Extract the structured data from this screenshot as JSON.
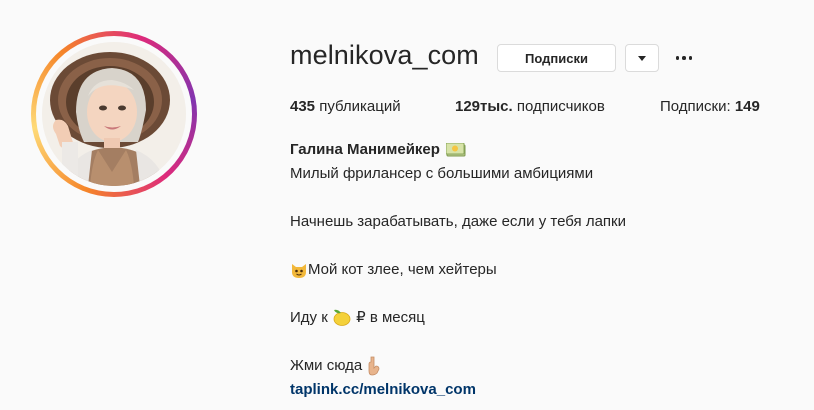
{
  "profile": {
    "username": "melnikova_com",
    "following_button": "Подписки",
    "stats": {
      "posts_count": "435",
      "posts_label": "публикаций",
      "followers_count": "129тыс.",
      "followers_label": "подписчиков",
      "following_label": "Подписки:",
      "following_count": "149"
    },
    "bio": {
      "full_name": "Галина Манимейкер",
      "line1": "Милый фрилансер с большими амбициями",
      "line2": "Начнешь зарабатывать, даже если у тебя лапки",
      "line3": "Мой кот злее, чем хейтеры",
      "line4_before": "Иду к",
      "line4_after": "₽ в месяц",
      "line5": "Жми сюда",
      "link": "taplink.cc/melnikova_com"
    },
    "icons": [
      "money-icon",
      "cat-emoji-icon",
      "lemon-emoji-icon",
      "pointing-down-icon",
      "caret-down-icon",
      "more-dots-icon"
    ]
  },
  "colors": {
    "background": "#fafafa",
    "text": "#262626",
    "link": "#003569",
    "border": "#dbdbdb",
    "ring_orange": "#f58529",
    "ring_pink": "#dd2a7b"
  }
}
